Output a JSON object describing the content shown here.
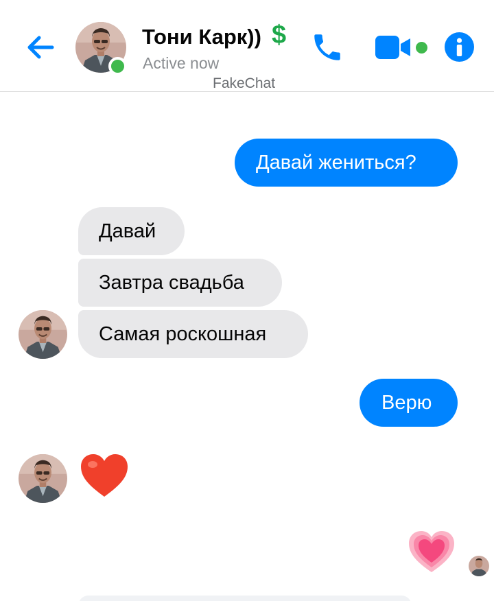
{
  "header": {
    "contact_name": "Тони Карк))",
    "money_symbol": "$",
    "status": "Active now",
    "watermark": "FakeChat"
  },
  "icons": {
    "back": "back-arrow-icon",
    "call": "phone-icon",
    "video": "video-camera-icon",
    "info": "info-icon",
    "reaction_received": "red-heart-emoji",
    "reaction_sent": "growing-pink-heart-emoji"
  },
  "messages": [
    {
      "direction": "outgoing",
      "text": "Давай жениться?"
    },
    {
      "direction": "incoming",
      "text": "Давай"
    },
    {
      "direction": "incoming",
      "text": "Завтра свадьба"
    },
    {
      "direction": "incoming",
      "text": "Самая роскошная"
    },
    {
      "direction": "outgoing",
      "text": "Верю"
    },
    {
      "direction": "incoming",
      "type": "emoji",
      "emoji": "red-heart"
    },
    {
      "direction": "outgoing",
      "type": "emoji",
      "emoji": "pink-heart"
    }
  ],
  "colors": {
    "accent": "#0084ff",
    "online": "#3fb94d",
    "money": "#1ea84a",
    "incoming_bubble": "#e8e8ea"
  }
}
